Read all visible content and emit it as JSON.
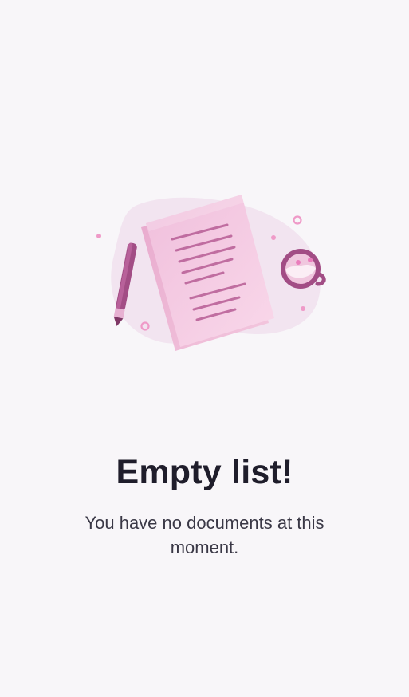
{
  "empty_state": {
    "title": "Empty list!",
    "message": "You have no documents at this moment.",
    "illustration_icon": "documents-illustration-icon"
  },
  "colors": {
    "background": "#f8f6f9",
    "title_text": "#1f1d2b",
    "message_text": "#3a3846",
    "accent_pink": "#e9b7d7",
    "accent_plum": "#a14b84"
  }
}
